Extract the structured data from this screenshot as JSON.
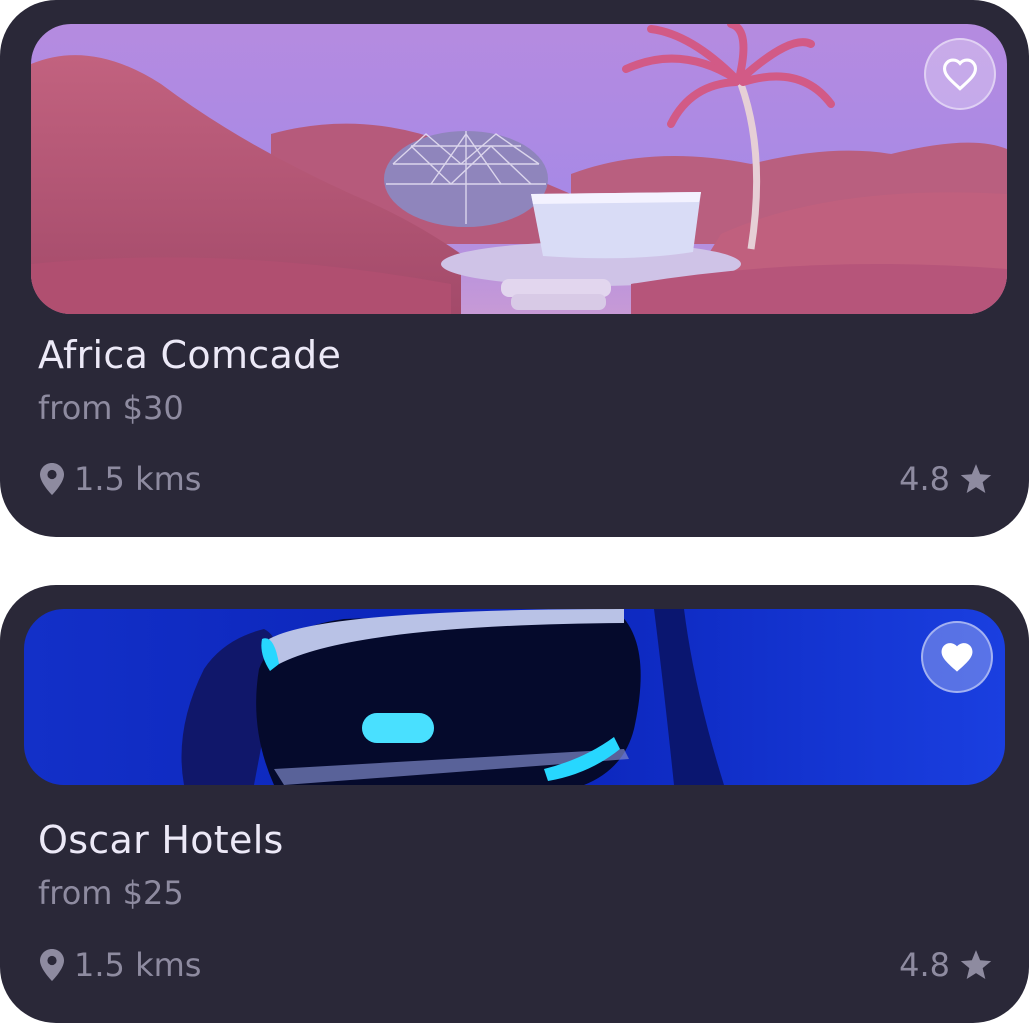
{
  "cards": [
    {
      "title": "Africa Comcade",
      "price": "from $30",
      "distance": "1.5 kms",
      "rating": "4.8",
      "favorite": false,
      "image": "pink-desert-dome-scene"
    },
    {
      "title": "Oscar Hotels",
      "price": "from $25",
      "distance": "1.5 kms",
      "rating": "4.8",
      "favorite": true,
      "image": "vr-headset-blue-scene"
    }
  ],
  "icons": {
    "favorite_outline": "heart-outline-icon",
    "favorite_filled": "heart-filled-icon",
    "location": "location-pin-icon",
    "rating": "star-icon"
  },
  "colors": {
    "card_background": "#2a2838",
    "title_text": "#ece9f7",
    "secondary_text": "#8e8ba0",
    "page_background": "#ffffff"
  }
}
